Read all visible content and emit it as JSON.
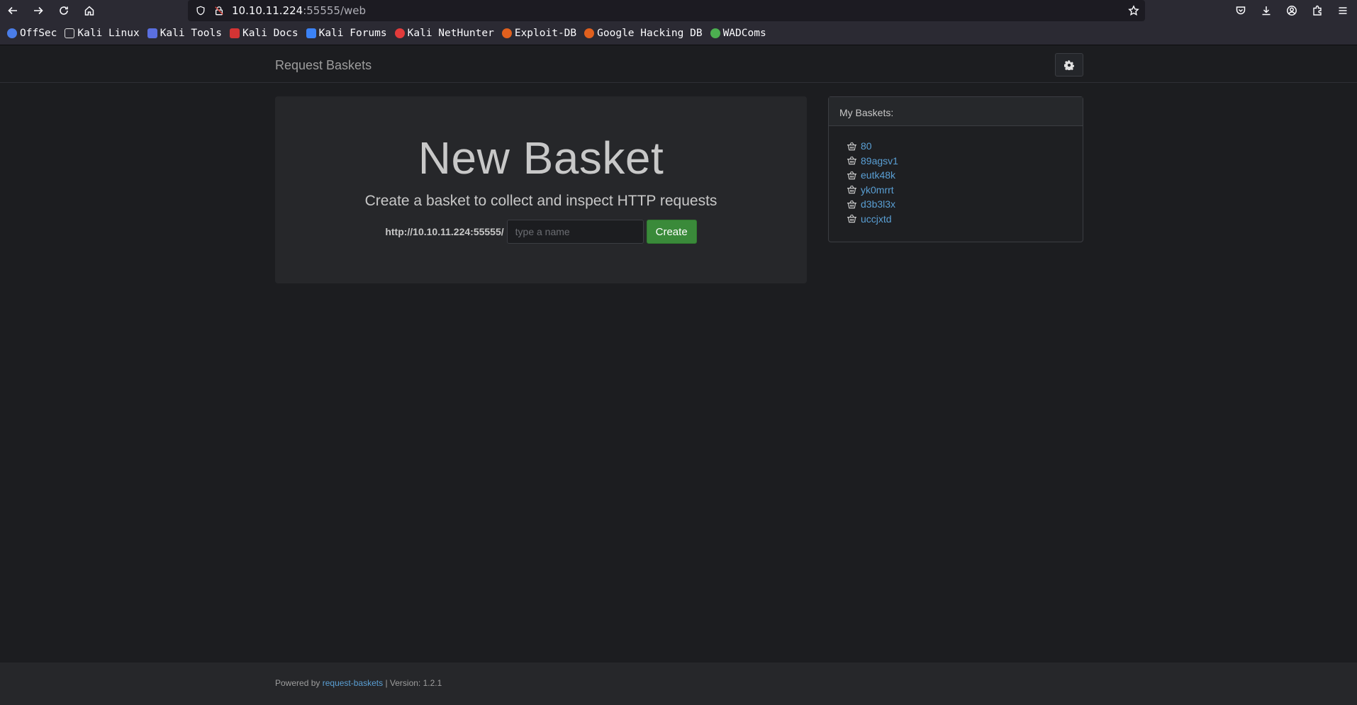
{
  "browser": {
    "url_host": "10.10.11.224",
    "url_rest": ":55555/web",
    "bookmarks": [
      {
        "label": "OffSec",
        "color": "#4a7de8"
      },
      {
        "label": "Kali Linux",
        "color": "#2b2a33"
      },
      {
        "label": "Kali Tools",
        "color": "#5a6fe0"
      },
      {
        "label": "Kali Docs",
        "color": "#d43434"
      },
      {
        "label": "Kali Forums",
        "color": "#3b82f6"
      },
      {
        "label": "Kali NetHunter",
        "color": "#e23b3b"
      },
      {
        "label": "Exploit-DB",
        "color": "#e0601e"
      },
      {
        "label": "Google Hacking DB",
        "color": "#e0601e"
      },
      {
        "label": "WADComs",
        "color": "#4caf50"
      }
    ]
  },
  "navbar": {
    "brand": "Request Baskets"
  },
  "hero": {
    "title": "New Basket",
    "subtitle": "Create a basket to collect and inspect HTTP requests",
    "url_prefix": "http://10.10.11.224:55555/",
    "input_placeholder": "type a name",
    "input_value": "",
    "create_label": "Create"
  },
  "baskets_panel": {
    "heading": "My Baskets:",
    "items": [
      "80",
      "89agsv1",
      "eutk48k",
      "yk0mrrt",
      "d3b3l3x",
      "uccjxtd"
    ]
  },
  "footer": {
    "powered_by": "Powered by",
    "link_text": "request-baskets",
    "version": "| Version: 1.2.1"
  },
  "colors": {
    "accent_link": "#5a9fd4",
    "create_button": "#3a8a3a",
    "page_bg": "#1c1d20"
  }
}
